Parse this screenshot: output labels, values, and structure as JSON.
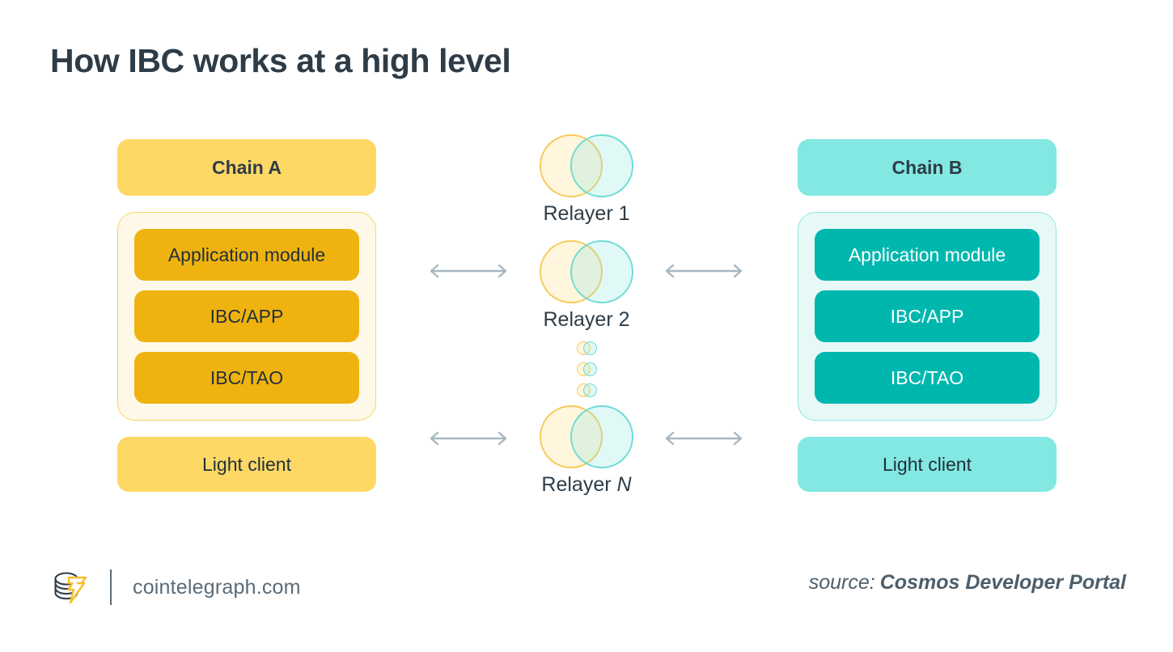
{
  "title": "How IBC works at a high level",
  "chains": [
    {
      "side": "left",
      "header": "Chain A",
      "layers": [
        "Application module",
        "IBC/APP",
        "IBC/TAO"
      ],
      "light_client": "Light client",
      "colors": {
        "header_bg": "#FDD865",
        "container_bg": "#FEF8E9",
        "container_border": "#FBD363",
        "layer_bg": "#EFB310",
        "layer_text": "#22303A"
      }
    },
    {
      "side": "right",
      "header": "Chain B",
      "layers": [
        "Application module",
        "IBC/APP",
        "IBC/TAO"
      ],
      "light_client": "Light client",
      "colors": {
        "header_bg": "#82E8E1",
        "container_bg": "#E7F9F7",
        "container_border": "#8FE6E0",
        "layer_bg": "#00B7AE",
        "layer_text": "#FFFFFF"
      }
    }
  ],
  "relayers": {
    "first": "Relayer 1",
    "second": "Relayer 2",
    "last_prefix": "Relayer ",
    "last_italic": "N",
    "ellipsis_count": 3,
    "venn_colors": {
      "left_circle_border": "#F8CA5A",
      "right_circle_border": "#6FDCD6"
    }
  },
  "arrows": {
    "icon": "double-headed-arrow",
    "color": "#A7B8C2",
    "count": 4
  },
  "footer": {
    "logo": "cointelegraph-logo-icon",
    "site": "cointelegraph.com",
    "source_label": "source:",
    "source_value": "Cosmos Developer Portal"
  }
}
